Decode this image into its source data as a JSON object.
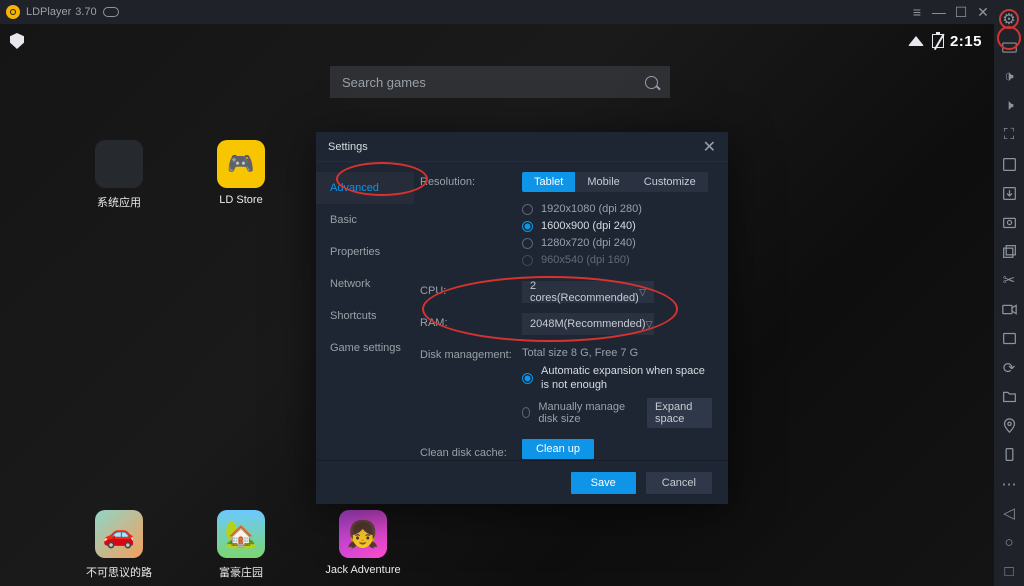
{
  "titlebar": {
    "app": "LDPlayer",
    "ver": "3.70"
  },
  "status": {
    "time": "2:15"
  },
  "search": {
    "placeholder": "Search games"
  },
  "desktop_icons": [
    {
      "name": "系统应用"
    },
    {
      "name": "LD Store"
    },
    {
      "name": "不可思议的路"
    },
    {
      "name": "富豪庄园"
    },
    {
      "name": "Jack Adventure"
    }
  ],
  "dialog": {
    "title": "Settings",
    "nav": [
      "Advanced",
      "Basic",
      "Properties",
      "Network",
      "Shortcuts",
      "Game settings"
    ],
    "active_nav": "Advanced",
    "resolution": {
      "label": "Resolution:",
      "tabs": [
        "Tablet",
        "Mobile",
        "Customize"
      ],
      "active_tab": "Tablet",
      "options": [
        {
          "text": "1920x1080  (dpi 280)",
          "on": false
        },
        {
          "text": "1600x900  (dpi 240)",
          "on": true
        },
        {
          "text": "1280x720  (dpi 240)",
          "on": false
        },
        {
          "text": "960x540  (dpi 160)",
          "on": false
        }
      ]
    },
    "cpu": {
      "label": "CPU:",
      "value": "2 cores(Recommended)"
    },
    "ram": {
      "label": "RAM:",
      "value": "2048M(Recommended)"
    },
    "disk": {
      "label": "Disk management:",
      "summary": "Total size 8 G,  Free 7 G",
      "opt1": "Automatic expansion when space is not enough",
      "opt2": "Manually manage disk size",
      "expand": "Expand space"
    },
    "clean": {
      "label": "Clean disk cache:",
      "btn": "Clean up"
    },
    "footer": {
      "save": "Save",
      "cancel": "Cancel"
    }
  }
}
